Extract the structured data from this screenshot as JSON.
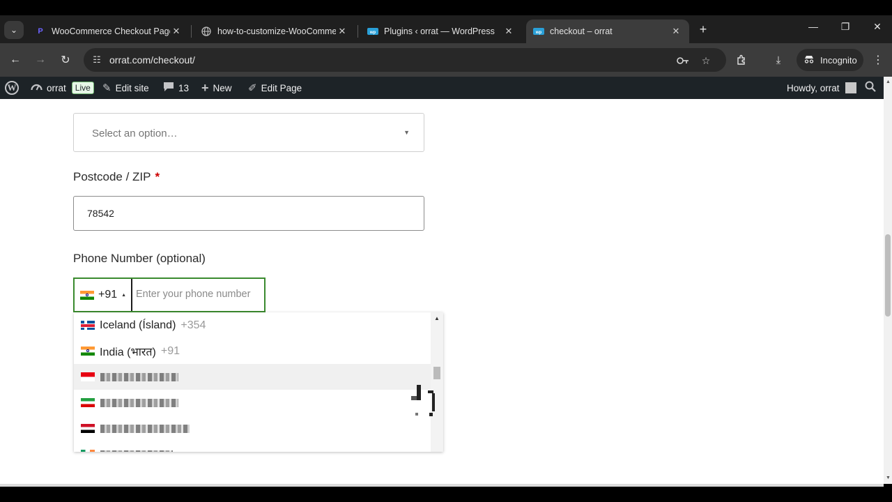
{
  "browser": {
    "tabs": [
      {
        "title": "WooCommerce Checkout Page",
        "favicon": "P",
        "favicon_color": "#6c63ff",
        "active": false
      },
      {
        "title": "how-to-customize-WooCommerce",
        "favicon": "globe-icon",
        "favicon_color": "#bdbdbd",
        "active": false
      },
      {
        "title": "Plugins ‹ orrat — WordPress",
        "favicon": "wp",
        "favicon_color": "#2aa0d8",
        "active": false
      },
      {
        "title": "checkout – orrat",
        "favicon": "wp",
        "favicon_color": "#2aa0d8",
        "active": true
      }
    ],
    "url": "orrat.com/checkout/",
    "incognito_label": "Incognito"
  },
  "adminbar": {
    "site_name": "orrat",
    "live_badge": "Live",
    "edit_site": "Edit site",
    "comments_count": "13",
    "new_label": "New",
    "edit_page": "Edit Page",
    "howdy": "Howdy, orrat"
  },
  "form": {
    "state_select_placeholder": "Select an option…",
    "postcode_label": "Postcode / ZIP",
    "postcode_required": "*",
    "postcode_value": "78542",
    "phone_label": "Phone Number (optional)",
    "phone_dial_code": "+91",
    "phone_placeholder": "Enter your phone number"
  },
  "country_dropdown": {
    "items": [
      {
        "name": "Iceland (Ísland)",
        "dial": "+354",
        "flag": "flag-is"
      },
      {
        "name": "India (भारत)",
        "dial": "+91",
        "flag": "flag-in"
      }
    ]
  },
  "colors": {
    "admin_bar": "#1d2327",
    "focus_border": "#3a8a2e",
    "required": "#cc0000"
  }
}
